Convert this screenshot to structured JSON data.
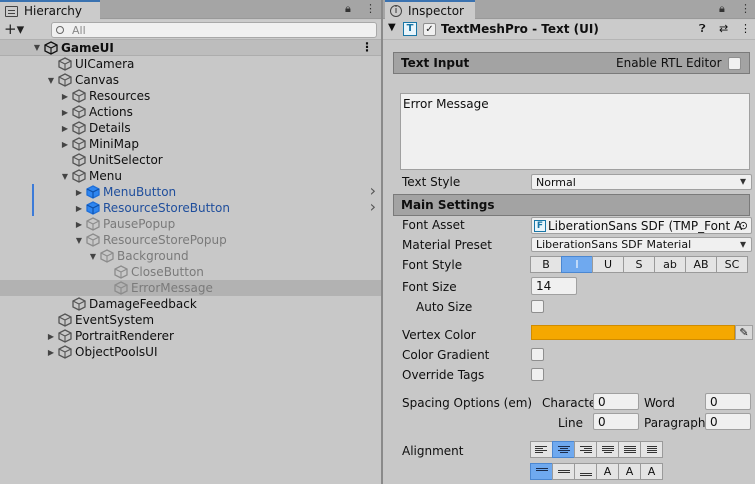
{
  "hierarchy": {
    "tab_label": "Hierarchy",
    "search_placeholder": "All",
    "add_label": "+▾",
    "rows": [
      {
        "label": "GameUI",
        "indent": 0,
        "arrow": "▼",
        "style": "scene",
        "icon": "unity-logo-icon"
      },
      {
        "label": "UICamera",
        "indent": 1,
        "arrow": "",
        "style": "normal",
        "icon": "gameobject-icon"
      },
      {
        "label": "Canvas",
        "indent": 1,
        "arrow": "▼",
        "style": "normal",
        "icon": "gameobject-icon"
      },
      {
        "label": "Resources",
        "indent": 2,
        "arrow": "▶",
        "style": "normal",
        "icon": "gameobject-icon"
      },
      {
        "label": "Actions",
        "indent": 2,
        "arrow": "▶",
        "style": "normal",
        "icon": "gameobject-icon"
      },
      {
        "label": "Details",
        "indent": 2,
        "arrow": "▶",
        "style": "normal",
        "icon": "gameobject-icon"
      },
      {
        "label": "MiniMap",
        "indent": 2,
        "arrow": "▶",
        "style": "normal",
        "icon": "gameobject-icon"
      },
      {
        "label": "UnitSelector",
        "indent": 2,
        "arrow": "",
        "style": "normal",
        "icon": "gameobject-icon"
      },
      {
        "label": "Menu",
        "indent": 2,
        "arrow": "▼",
        "style": "normal",
        "icon": "gameobject-icon"
      },
      {
        "label": "MenuButton",
        "indent": 3,
        "arrow": "▶",
        "style": "blue",
        "icon": "prefab-icon"
      },
      {
        "label": "ResourceStoreButton",
        "indent": 3,
        "arrow": "▶",
        "style": "blue",
        "icon": "prefab-icon"
      },
      {
        "label": "PausePopup",
        "indent": 3,
        "arrow": "▶",
        "style": "gray",
        "icon": "gameobject-icon"
      },
      {
        "label": "ResourceStorePopup",
        "indent": 3,
        "arrow": "▼",
        "style": "gray",
        "icon": "gameobject-icon"
      },
      {
        "label": "Background",
        "indent": 4,
        "arrow": "▼",
        "style": "gray",
        "icon": "gameobject-icon"
      },
      {
        "label": "CloseButton",
        "indent": 5,
        "arrow": "",
        "style": "gray",
        "icon": "gameobject-icon"
      },
      {
        "label": "ErrorMessage",
        "indent": 5,
        "arrow": "",
        "style": "gray sel",
        "icon": "gameobject-icon"
      },
      {
        "label": "DamageFeedback",
        "indent": 2,
        "arrow": "",
        "style": "normal",
        "icon": "gameobject-icon"
      },
      {
        "label": "EventSystem",
        "indent": 1,
        "arrow": "",
        "style": "normal",
        "icon": "gameobject-icon"
      },
      {
        "label": "PortraitRenderer",
        "indent": 1,
        "arrow": "▶",
        "style": "normal",
        "icon": "gameobject-icon"
      },
      {
        "label": "ObjectPoolsUI",
        "indent": 1,
        "arrow": "▶",
        "style": "normal",
        "icon": "gameobject-icon"
      }
    ]
  },
  "inspector": {
    "tab_label": "Inspector",
    "component_title": "TextMeshPro - Text (UI)",
    "text_input_section": "Text Input",
    "enable_rtl_label": "Enable RTL Editor",
    "text_value": "Error Message",
    "text_style_label": "Text Style",
    "text_style_value": "Normal",
    "main_settings_section": "Main Settings",
    "font_asset_label": "Font Asset",
    "font_asset_value": "LiberationSans SDF (TMP_Font A",
    "material_preset_label": "Material Preset",
    "material_preset_value": "LiberationSans SDF Material",
    "font_style_label": "Font Style",
    "font_style_buttons": [
      "B",
      "I",
      "U",
      "S",
      "ab",
      "AB",
      "SC"
    ],
    "font_style_active": "I",
    "font_size_label": "Font Size",
    "font_size_value": "14",
    "auto_size_label": "Auto Size",
    "vertex_color_label": "Vertex Color",
    "vertex_color": "#f5a800",
    "color_gradient_label": "Color Gradient",
    "override_tags_label": "Override Tags",
    "spacing_label": "Spacing Options (em)",
    "character_label": "Character",
    "character_value": "0",
    "word_label": "Word",
    "word_value": "0",
    "line_label": "Line",
    "line_value": "0",
    "paragraph_label": "Paragraph",
    "paragraph_value": "0",
    "alignment_label": "Alignment"
  }
}
